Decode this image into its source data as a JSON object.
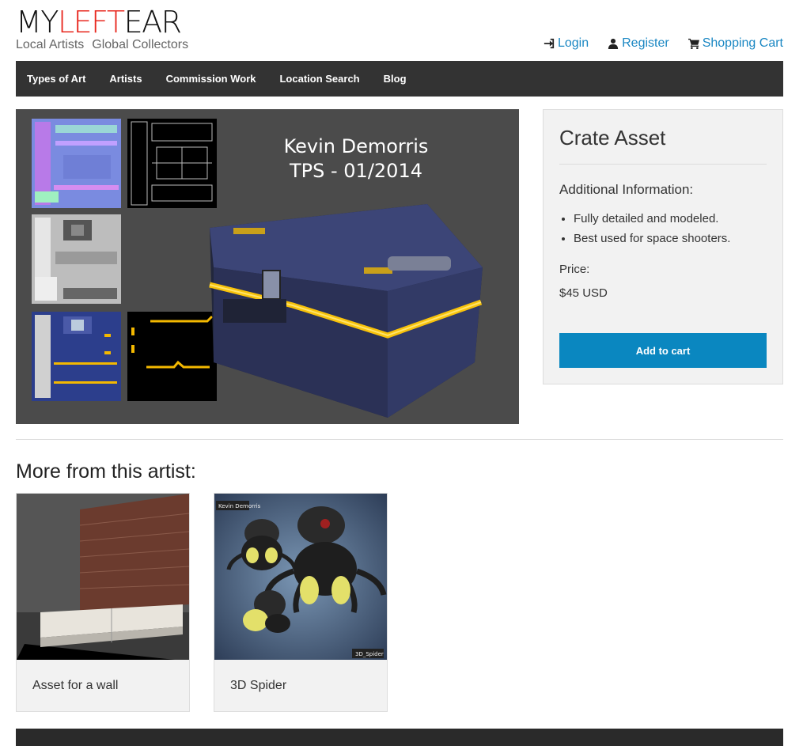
{
  "logo": {
    "part1": "MY",
    "part2": "LEFT",
    "part3": "EAR",
    "tagline_left": "Local Artists",
    "tagline_right": "Global Collectors"
  },
  "topnav": {
    "login": "Login",
    "register": "Register",
    "cart": "Shopping Cart"
  },
  "mainnav": [
    "Types of Art",
    "Artists",
    "Commission Work",
    "Location Search",
    "Blog"
  ],
  "hero": {
    "line1": "Kevin  Demorris",
    "line2": "TPS - 01/2014"
  },
  "product": {
    "title": "Crate Asset",
    "info_heading": "Additional Information:",
    "bullets": [
      "Fully detailed and modeled.",
      "Best used for space shooters."
    ],
    "price_label": "Price:",
    "price_value": "$45 USD",
    "button_label": "Add to cart"
  },
  "more": {
    "heading": "More from this artist:",
    "items": [
      {
        "caption": "Asset for a wall"
      },
      {
        "caption": "3D Spider",
        "thumb_label_top": "Kevin Demorris",
        "thumb_label_bottom": "3D_Spider"
      }
    ]
  },
  "colors": {
    "accent": "#0a87c0",
    "logo_red": "#e8281f",
    "nav_bg": "#333333",
    "link": "#1a87c3"
  },
  "icons": [
    "sign-in-icon",
    "user-icon",
    "shopping-cart-icon"
  ]
}
